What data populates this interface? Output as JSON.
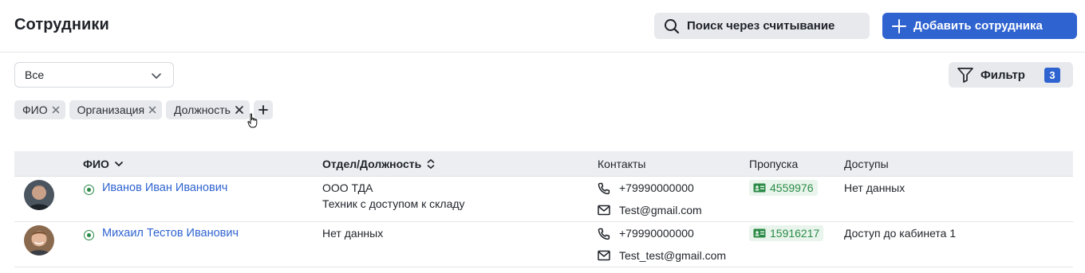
{
  "header": {
    "title": "Сотрудники",
    "scan_button": "Поиск через считывание",
    "add_button": "Добавить сотрудника"
  },
  "toolbar": {
    "select_value": "Все",
    "filter_label": "Фильтр",
    "filter_count": "3"
  },
  "chips": [
    {
      "label": "ФИО"
    },
    {
      "label": "Организация"
    },
    {
      "label": "Должность"
    }
  ],
  "table": {
    "headers": {
      "name": "ФИО",
      "department": "Отдел/Должность",
      "contacts": "Контакты",
      "passes": "Пропуска",
      "access": "Доступы"
    },
    "rows": [
      {
        "name": "Иванов Иван Иванович",
        "department": "ООО ТДА",
        "position": "Техник с доступом к складу",
        "phone": "+79990000000",
        "email": "Test@gmail.com",
        "pass": "4559976",
        "access": "Нет данных"
      },
      {
        "name": "Михаил Тестов Иванович",
        "department": "Нет данных",
        "position": "",
        "phone": "+79990000000",
        "email": "Test_test@gmail.com",
        "pass": "15916217",
        "access": "Доступ до кабинета 1"
      }
    ]
  },
  "colors": {
    "accent": "#2f63d0",
    "status_active": "#2a8a46",
    "pass_bg": "#e9f5ec"
  },
  "icons": {
    "scan": "search-icon",
    "add": "plus-icon",
    "filter": "funnel-icon",
    "phone": "phone-icon",
    "email": "mail-icon",
    "pass": "id-card-icon"
  }
}
